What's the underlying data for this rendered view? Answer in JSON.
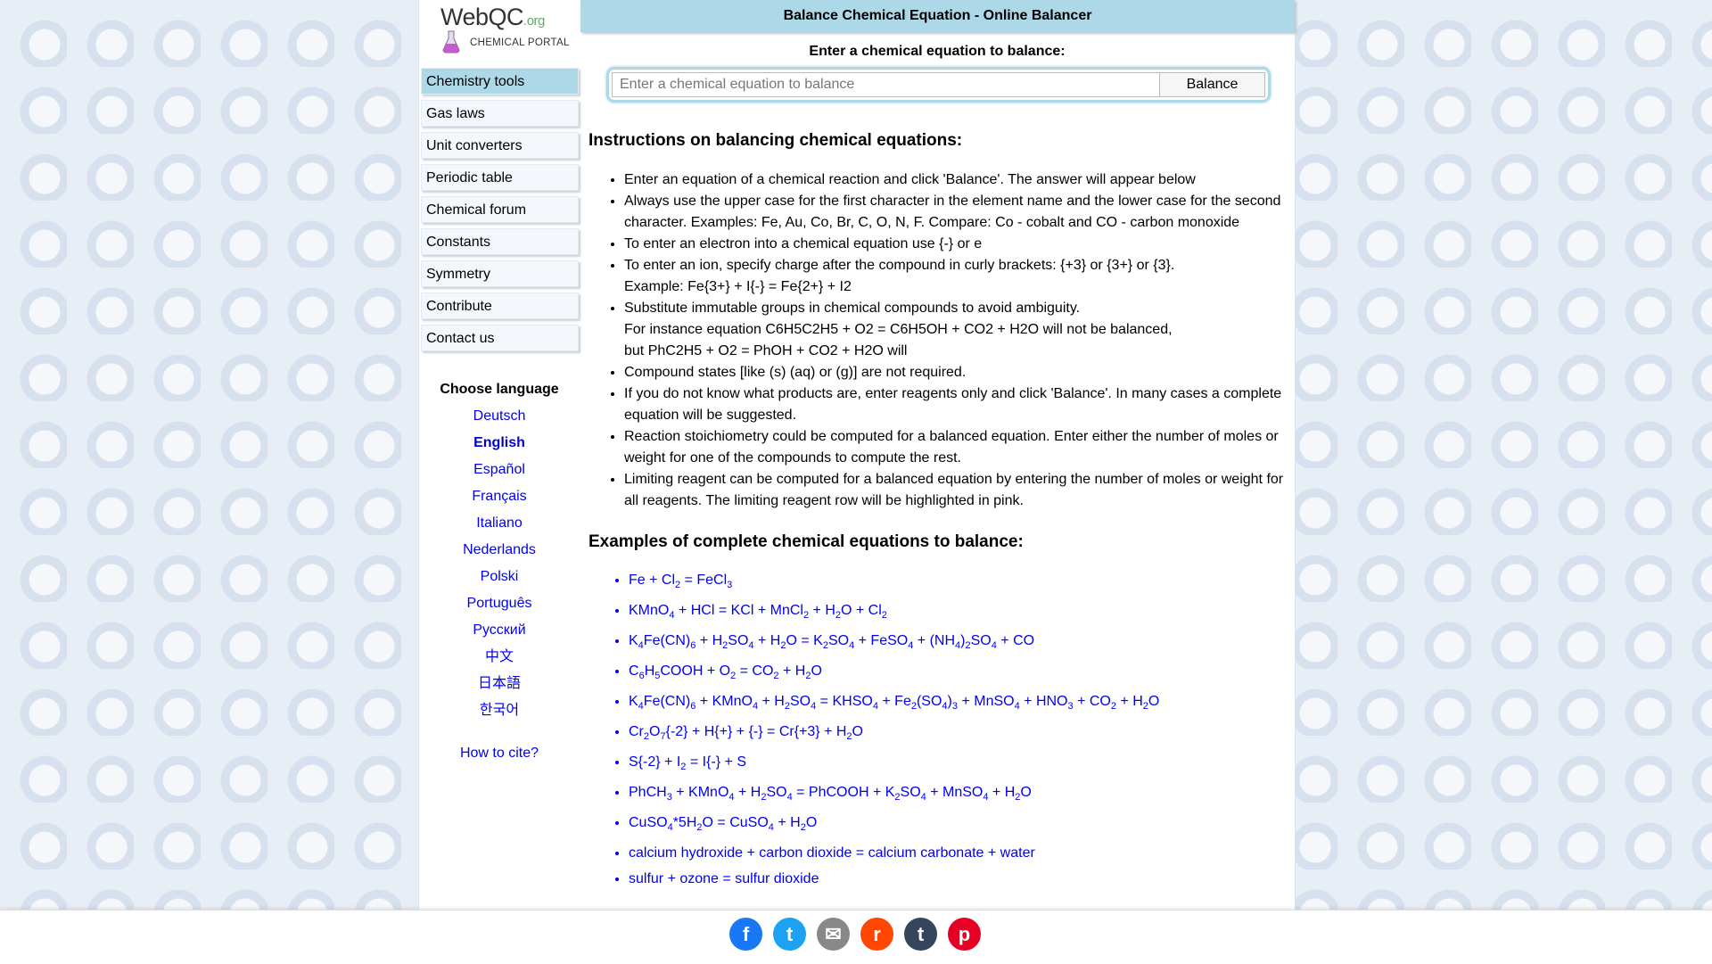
{
  "logo": {
    "brand": "WebQC",
    "org": ".org",
    "subtitle": "CHEMICAL PORTAL"
  },
  "sidebar": {
    "items": [
      {
        "label": "Chemistry tools",
        "active": true
      },
      {
        "label": "Gas laws"
      },
      {
        "label": "Unit converters"
      },
      {
        "label": "Periodic table"
      },
      {
        "label": "Chemical forum"
      },
      {
        "label": "Constants"
      },
      {
        "label": "Symmetry"
      },
      {
        "label": "Contribute"
      },
      {
        "label": "Contact us"
      }
    ],
    "language_title": "Choose language",
    "languages": [
      "Deutsch",
      "English",
      "Español",
      "Français",
      "Italiano",
      "Nederlands",
      "Polski",
      "Português",
      "Русский",
      "中文",
      "日本語",
      "한국어"
    ],
    "current_language": "English",
    "cite": "How to cite?"
  },
  "header": {
    "title": "Balance Chemical Equation - Online Balancer"
  },
  "form": {
    "prompt": "Enter a chemical equation to balance:",
    "placeholder": "Enter a chemical equation to balance",
    "button": "Balance"
  },
  "instructions": {
    "heading": "Instructions on balancing chemical equations:",
    "items": [
      [
        "Enter an equation of a chemical reaction and click 'Balance'. The answer will appear below"
      ],
      [
        "Always use the upper case for the first character in the element name and the lower case for the second character. Examples: Fe, Au, Co, Br, C, O, N, F. Compare: Co - cobalt and CO - carbon monoxide"
      ],
      [
        "To enter an electron into a chemical equation use {-} or e"
      ],
      [
        "To enter an ion, specify charge after the compound in curly brackets: {+3} or {3+} or {3}.",
        "Example: Fe{3+} + I{-} = Fe{2+} + I2"
      ],
      [
        "Substitute immutable groups in chemical compounds to avoid ambiguity.",
        "For instance equation C6H5C2H5 + O2 = C6H5OH + CO2 + H2O will not be balanced,",
        "but PhC2H5 + O2 = PhOH + CO2 + H2O will"
      ],
      [
        "Compound states [like (s) (aq) or (g)] are not required."
      ],
      [
        "If you do not know what products are, enter reagents only and click 'Balance'. In many cases a complete equation will be suggested."
      ],
      [
        "Reaction stoichiometry could be computed for a balanced equation. Enter either the number of moles or weight for one of the compounds to compute the rest."
      ],
      [
        "Limiting reagent can be computed for a balanced equation by entering the number of moles or weight for all reagents. The limiting reagent row will be highlighted in pink."
      ]
    ]
  },
  "examples": {
    "heading": "Examples of complete chemical equations to balance:",
    "items": [
      "Fe + Cl_{2} = FeCl_{3}",
      "KMnO_{4} + HCl = KCl + MnCl_{2} + H_{2}O + Cl_{2}",
      "K_{4}Fe(CN)_{6} + H_{2}SO_{4} + H_{2}O = K_{2}SO_{4} + FeSO_{4} + (NH_{4})_{2}SO_{4} + CO",
      "C_{6}H_{5}COOH + O_{2} = CO_{2} + H_{2}O",
      "K_{4}Fe(CN)_{6} + KMnO_{4} + H_{2}SO_{4} = KHSO_{4} + Fe_{2}(SO_{4})_{3} + MnSO_{4} + HNO_{3} + CO_{2} + H_{2}O",
      "Cr_{2}O_{7}{-2} + H{+} + {-} = Cr{+3} + H_{2}O",
      "S{-2} + I_{2} = I{-} + S",
      "PhCH_{3} + KMnO_{4} + H_{2}SO_{4} = PhCOOH + K_{2}SO_{4} + MnSO_{4} + H_{2}O",
      "CuSO_{4}*5H_{2}O = CuSO_{4} + H_{2}O",
      "calcium hydroxide + carbon dioxide = calcium carbonate + water",
      "sulfur + ozone = sulfur dioxide"
    ]
  },
  "share": [
    {
      "name": "facebook-icon",
      "glyph": "f",
      "color": "#1877f2"
    },
    {
      "name": "twitter-icon",
      "glyph": "t",
      "color": "#1da1f2"
    },
    {
      "name": "email-icon",
      "glyph": "✉",
      "color": "#888888"
    },
    {
      "name": "reddit-icon",
      "glyph": "r",
      "color": "#ff4500"
    },
    {
      "name": "tumblr-icon",
      "glyph": "t",
      "color": "#35465c"
    },
    {
      "name": "pinterest-icon",
      "glyph": "p",
      "color": "#e60023"
    }
  ]
}
